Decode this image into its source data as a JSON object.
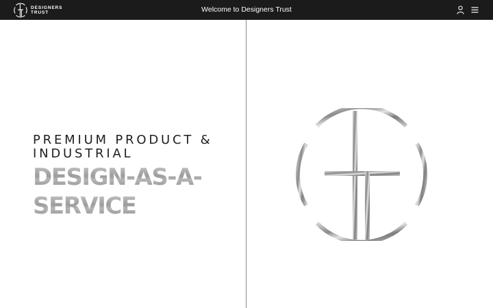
{
  "header": {
    "brand_line1": "DESIGNERS",
    "brand_line2": "TRUST",
    "welcome": "Welcome to Designers Trust",
    "icons": [
      "user-icon",
      "menu-icon"
    ]
  },
  "hero": {
    "line1": "PREMIUM PRODUCT &",
    "line2": "INDUSTRIAL",
    "big1": "DESIGN-AS-A-",
    "big2": "SERVICE"
  },
  "colors": {
    "header_bg": "#1b1b1b",
    "header_text": "#ffffff",
    "heading_dark": "#1e1e1e",
    "heading_metal": "#a3a3a3",
    "divider": "#8c8c8c"
  }
}
